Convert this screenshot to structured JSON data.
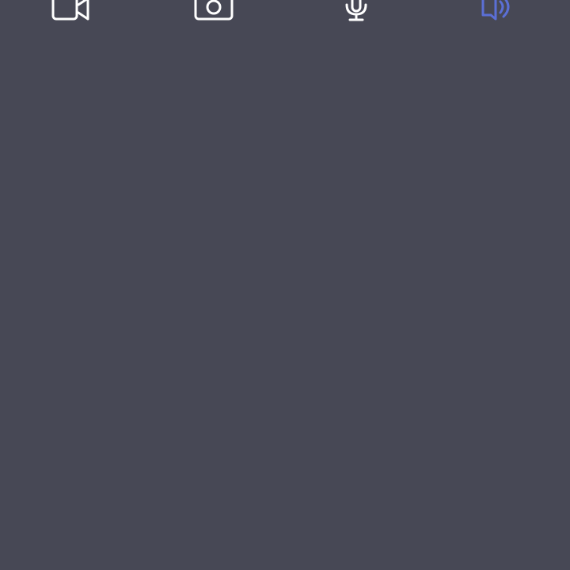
{
  "toolbar": {
    "items": [
      {
        "icon": "video-camera-icon",
        "active": false
      },
      {
        "icon": "photo-camera-icon",
        "active": false
      },
      {
        "icon": "microphone-icon",
        "active": false
      },
      {
        "icon": "speaker-icon",
        "active": true
      }
    ]
  },
  "colors": {
    "background": "#474855",
    "icon": "#ffffff",
    "active_icon": "#5b6fd6"
  }
}
